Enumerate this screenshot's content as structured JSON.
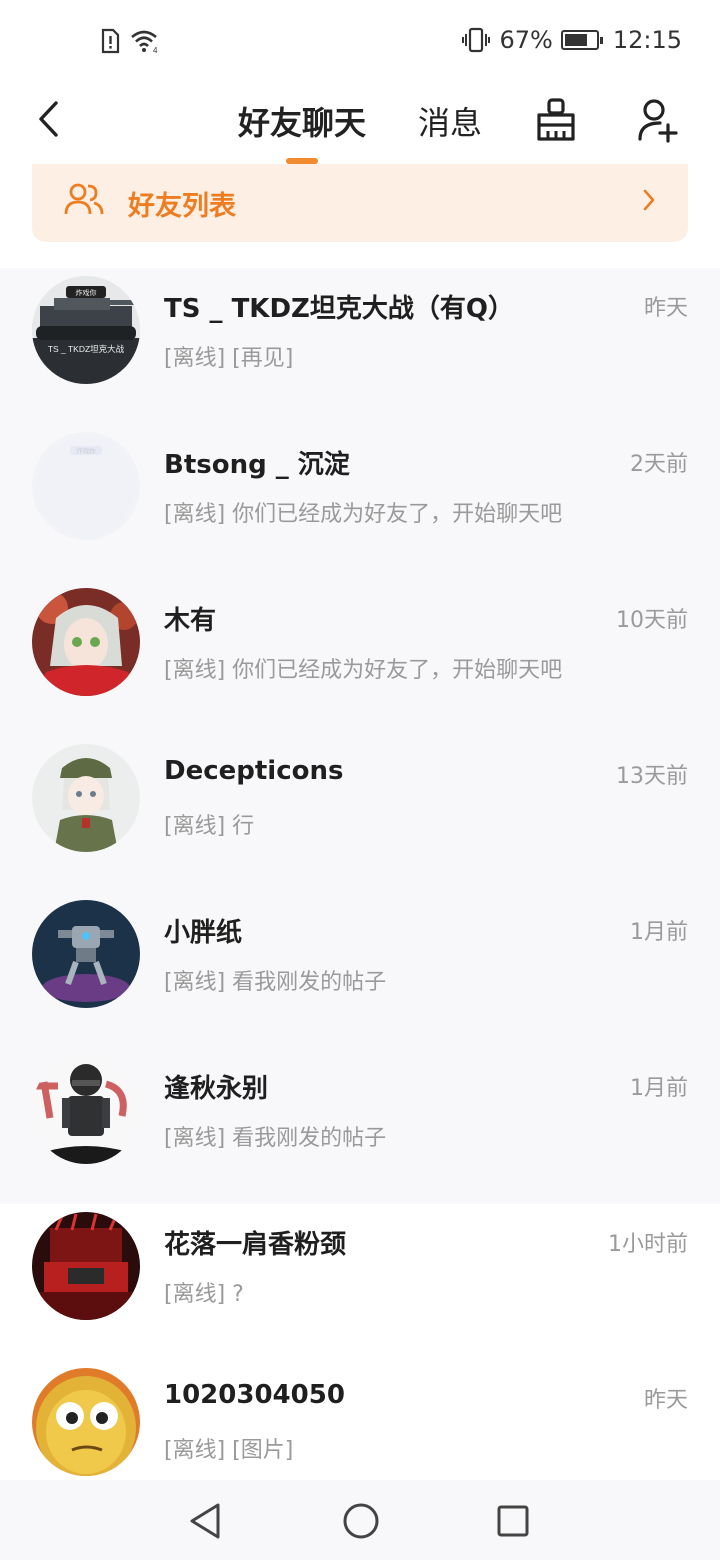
{
  "status_bar": {
    "battery_percent": "67%",
    "battery_level": 0.67,
    "time": "12:15",
    "icons": [
      "sim-alert-icon",
      "wifi-icon",
      "vibrate-icon",
      "battery-icon"
    ]
  },
  "header": {
    "tabs": [
      {
        "label": "好友聊天",
        "active": true
      },
      {
        "label": "消息",
        "active": false
      }
    ],
    "accent_color": "#f28a2e",
    "icons": [
      "back-arrow-icon",
      "broom-clean-icon",
      "add-user-icon"
    ]
  },
  "friend_list_banner": {
    "label": "好友列表",
    "icon": "friends-icon",
    "accent_color": "#ee7d22"
  },
  "chats": [
    {
      "name": "TS _ TKDZ坦克大战（有Q）",
      "time": "昨天",
      "preview": "[离线] [再见]",
      "avatar_text": "TS _ TKDZ坦克大战",
      "avatar_badge": "炸戏你",
      "avatar_kind": "tank"
    },
    {
      "name": "Btsong _ 沉淀",
      "time": "2天前",
      "preview": "[离线] 你们已经成为好友了，开始聊天吧",
      "avatar_badge": "炸戏你",
      "avatar_kind": "blank"
    },
    {
      "name": "木有",
      "time": "10天前",
      "preview": "[离线] 你们已经成为好友了，开始聊天吧",
      "avatar_kind": "anime-girl-red"
    },
    {
      "name": "Decepticons",
      "time": "13天前",
      "preview": "[离线] 行",
      "avatar_kind": "anime-soldier"
    },
    {
      "name": "小胖纸",
      "time": "1月前",
      "preview": "[离线] 看我刚发的帖子",
      "avatar_kind": "mech"
    },
    {
      "name": "逢秋永别",
      "time": "1月前",
      "preview": "[离线] 看我刚发的帖子",
      "avatar_kind": "trooper"
    },
    {
      "name": "花落一肩香粉颈",
      "time": "1小时前",
      "preview": "[离线] ?",
      "avatar_kind": "red-mech"
    },
    {
      "name": "1020304050",
      "time": "昨天",
      "preview": "[离线] [图片]",
      "avatar_kind": "wallnut"
    }
  ],
  "nav_bar": {
    "icons": [
      "nav-back-icon",
      "nav-home-icon",
      "nav-recent-icon"
    ]
  }
}
